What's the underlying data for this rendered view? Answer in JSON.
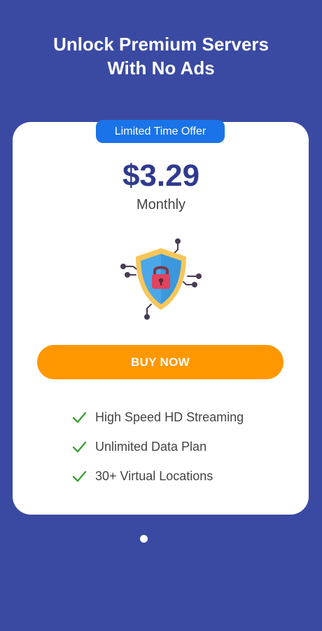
{
  "headline": {
    "line1": "Unlock Premium Servers",
    "line2": "With No Ads"
  },
  "card": {
    "badge": "Limited Time Offer",
    "price": "$3.29",
    "period": "Monthly",
    "illustration_icon": "security-shield-lock-icon",
    "buy_button_label": "BUY NOW",
    "features": [
      {
        "label": "High Speed HD Streaming",
        "icon": "check-icon"
      },
      {
        "label": "Unlimited Data Plan",
        "icon": "check-icon"
      },
      {
        "label": "30+ Virtual Locations",
        "icon": "check-icon"
      }
    ]
  },
  "pagination": {
    "total_pages": 1,
    "current_page": 1
  },
  "colors": {
    "background": "#3a4aa3",
    "badge": "#1a73e8",
    "price": "#2f3a8f",
    "button": "#ff9800",
    "check": "#3aa335"
  }
}
